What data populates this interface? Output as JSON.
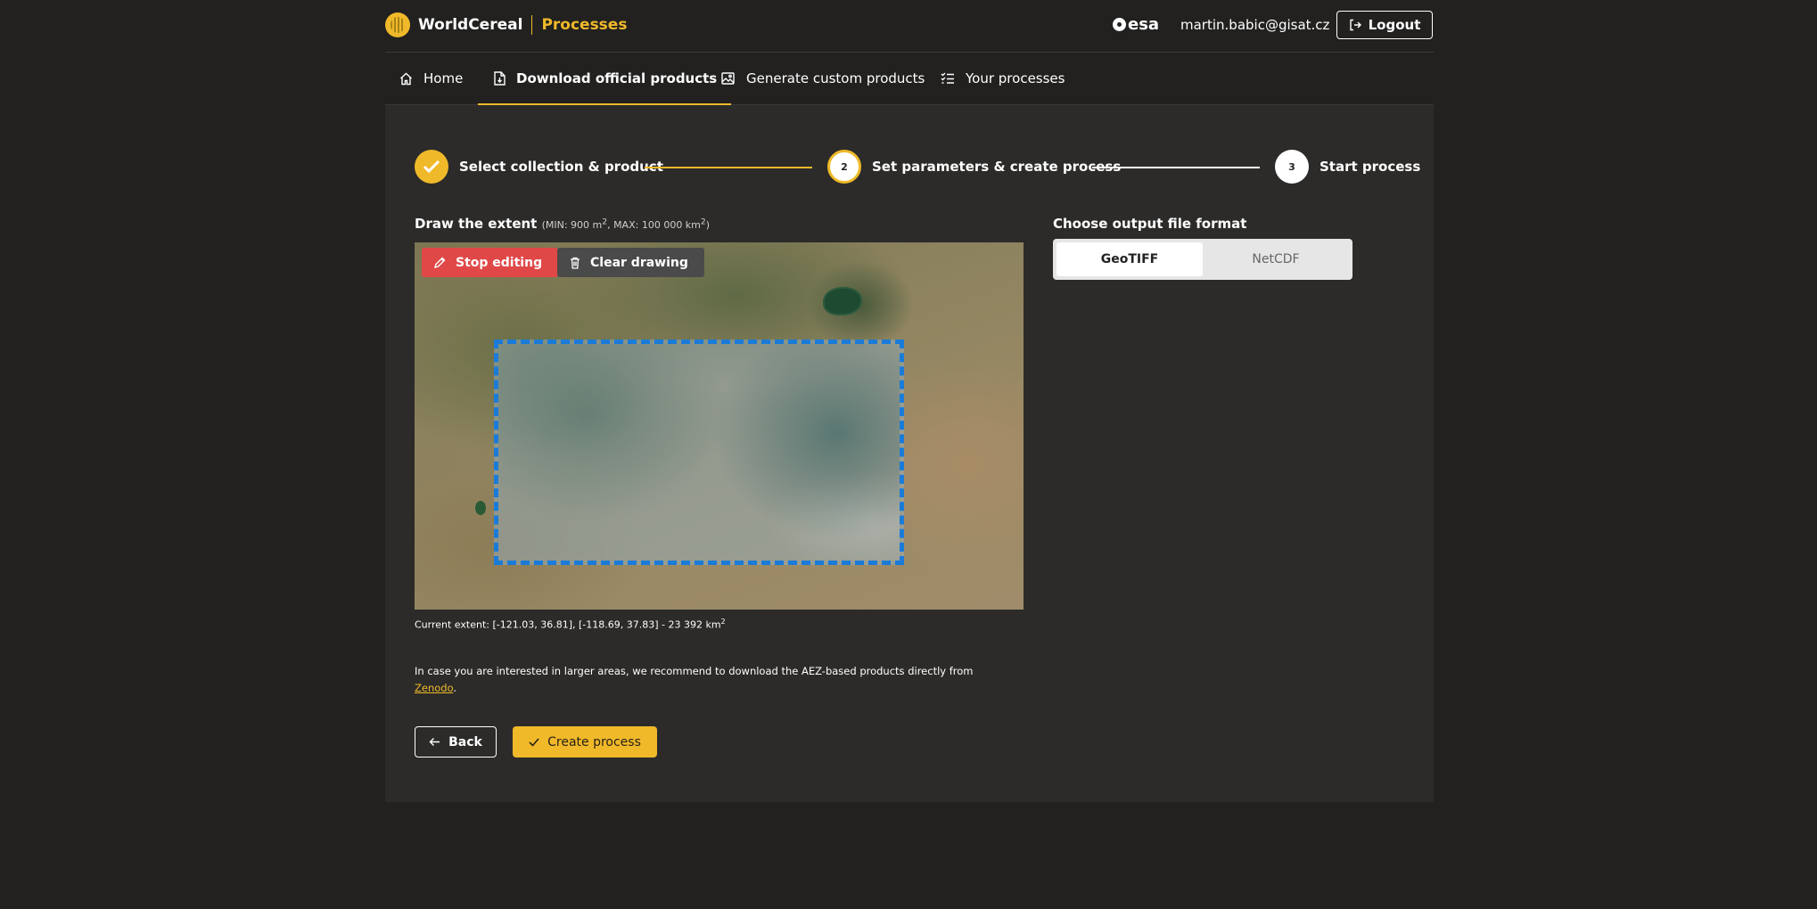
{
  "header": {
    "brand_name": "WorldCereal",
    "brand_sub": "Processes",
    "esa_label": "esa",
    "user_email": "martin.babic@gisat.cz",
    "logout_label": "Logout"
  },
  "tabs": [
    {
      "label": "Home",
      "icon": "home-icon",
      "active": false
    },
    {
      "label": "Download official products",
      "icon": "download-file-icon",
      "active": true
    },
    {
      "label": "Generate custom products",
      "icon": "image-edit-icon",
      "active": false
    },
    {
      "label": "Your processes",
      "icon": "checklist-icon",
      "active": false
    }
  ],
  "stepper": {
    "steps": [
      {
        "number": "",
        "label": "Select collection & product",
        "state": "done"
      },
      {
        "number": "2",
        "label": "Set parameters & create process",
        "state": "current"
      },
      {
        "number": "3",
        "label": "Start process",
        "state": "pending"
      }
    ]
  },
  "extent": {
    "title": "Draw the extent",
    "hint_prefix": "(MIN: 900 m",
    "hint_mid": ", MAX: 100 000 km",
    "hint_suffix": ")",
    "sup": "2",
    "stop_editing_label": "Stop editing",
    "clear_drawing_label": "Clear drawing",
    "current_extent_text": "Current extent: [-121.03, 36.81], [-118.69, 37.83] - 23 392 km",
    "current_extent_sup": "2",
    "info_text": "In case you are interested in larger areas, we recommend to download the AEZ-based products directly from ",
    "info_link": "Zenodo",
    "info_end": "."
  },
  "actions": {
    "back_label": "Back",
    "create_label": "Create process"
  },
  "output_format": {
    "title": "Choose output file format",
    "options": [
      "GeoTIFF",
      "NetCDF"
    ],
    "selected": "GeoTIFF"
  },
  "colors": {
    "accent": "#f0b92a",
    "stop_button": "#e04848",
    "drawing_border": "#1a7bd8",
    "background": "#222120",
    "panel": "#2c2b2a"
  }
}
